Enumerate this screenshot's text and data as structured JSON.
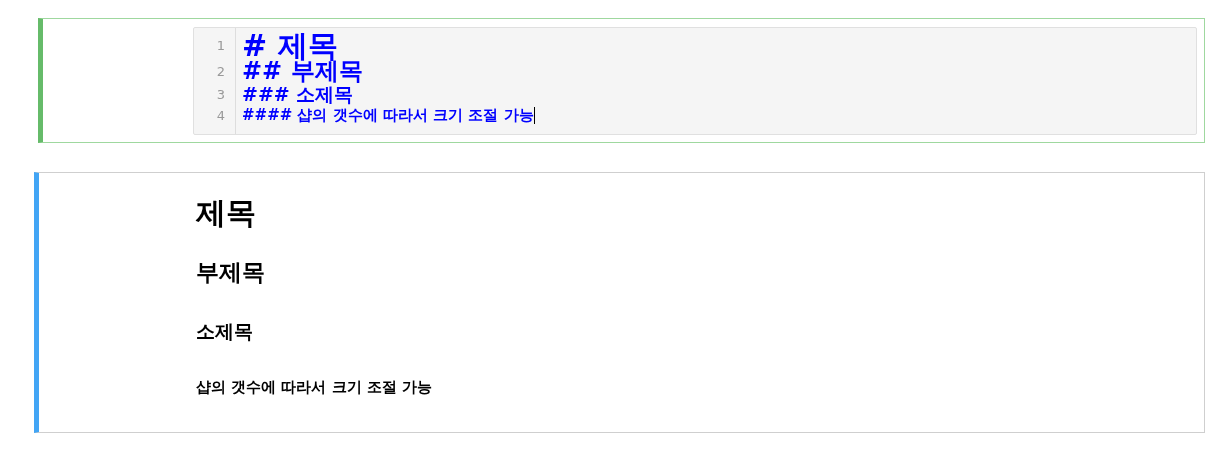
{
  "editor_cell": {
    "kind": "editor",
    "lines": [
      {
        "number": "1",
        "text": "# 제목",
        "kind": "h1",
        "cursor": false
      },
      {
        "number": "2",
        "text": "## 부제목",
        "kind": "h2",
        "cursor": false
      },
      {
        "number": "3",
        "text": "### 소제목",
        "kind": "h3",
        "cursor": false
      },
      {
        "number": "4",
        "text": "#### 샵의 갯수에 따라서 크기 조절 가능",
        "kind": "h4",
        "cursor": true
      }
    ]
  },
  "rendered_cell": {
    "kind": "rendered",
    "headings": [
      {
        "text": "제목",
        "kind": "h1"
      },
      {
        "text": "부제목",
        "kind": "h2"
      },
      {
        "text": "소제목",
        "kind": "h3"
      },
      {
        "text": "샵의 갯수에 따라서 크기 조절 가능",
        "kind": "h4"
      }
    ]
  }
}
